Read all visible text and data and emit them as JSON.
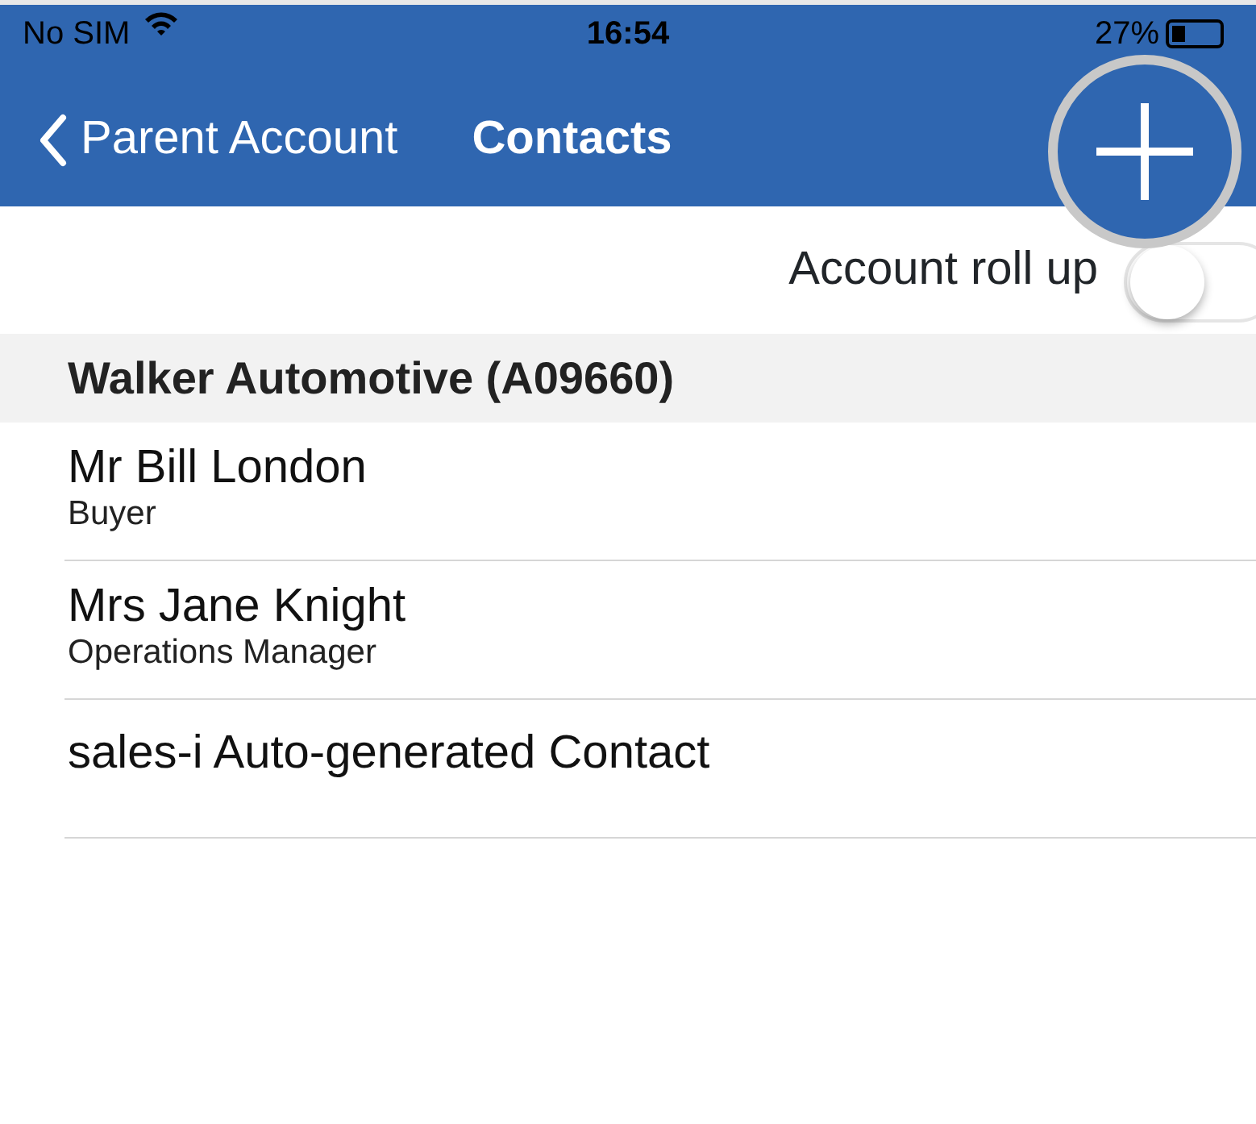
{
  "status_bar": {
    "carrier": "No SIM",
    "time": "16:54",
    "battery": "27%"
  },
  "nav": {
    "back_label": "Parent Account",
    "title": "Contacts"
  },
  "roll_up": {
    "label": "Account roll up",
    "on": false
  },
  "section": {
    "title": "Walker Automotive (A09660)"
  },
  "contacts": [
    {
      "name": "Mr Bill London",
      "role": "Buyer"
    },
    {
      "name": "Mrs Jane Knight",
      "role": "Operations Manager"
    },
    {
      "name": "sales-i Auto-generated Contact"
    }
  ]
}
